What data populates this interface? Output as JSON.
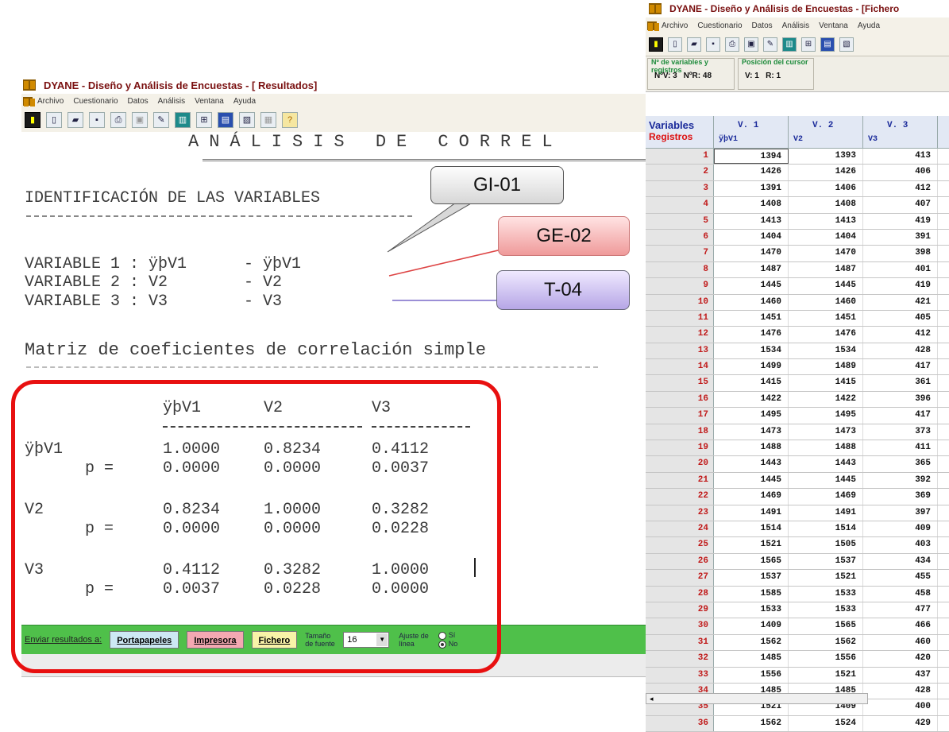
{
  "left_window": {
    "title": "DYANE - Diseño y Análisis de Encuestas - [ Resultados]",
    "menu": [
      "Archivo",
      "Cuestionario",
      "Datos",
      "Análisis",
      "Ventana",
      "Ayuda"
    ],
    "results": {
      "title": "ANÁLISIS DE CORREL",
      "ident_heading": "IDENTIFICACIÓN DE LAS VARIABLES",
      "variables": [
        "VARIABLE 1 : ÿþV1      - ÿþV1",
        "VARIABLE 2 : V2        - V2",
        "VARIABLE 3 : V3        - V3"
      ],
      "matrix_heading": "Matriz de coeficientes de correlación simple",
      "col_headers": [
        "ÿþV1",
        "V2",
        "V3"
      ],
      "rows": [
        {
          "name": "ÿþV1",
          "r": [
            "1.0000",
            "0.8234",
            "0.4112"
          ],
          "p_label": "p =",
          "p": [
            "0.0000",
            "0.0000",
            "0.0037"
          ]
        },
        {
          "name": "V2",
          "r": [
            "0.8234",
            "1.0000",
            "0.3282"
          ],
          "p_label": "p =",
          "p": [
            "0.0000",
            "0.0000",
            "0.0228"
          ]
        },
        {
          "name": "V3",
          "r": [
            "0.4112",
            "0.3282",
            "1.0000"
          ],
          "p_label": "p =",
          "p": [
            "0.0037",
            "0.0228",
            "0.0000"
          ]
        }
      ]
    },
    "statusbar": {
      "send_label": "Enviar resultados a:",
      "clipboard": "Portapapeles",
      "printer": "Impresora",
      "file": "Fichero",
      "font_size_label": "Tamaño de fuente",
      "font_size_value": "16",
      "wrap_label": "Ajuste de línea",
      "wrap_yes": "Sí",
      "wrap_no": "No"
    }
  },
  "callouts": [
    "GI-01",
    "GE-02",
    "T-04"
  ],
  "right_window": {
    "title": "DYANE - Diseño y Análisis de Encuestas - [Fichero",
    "menu": [
      "Archivo",
      "Cuestionario",
      "Datos",
      "Análisis",
      "Ventana",
      "Ayuda"
    ],
    "info": {
      "vars_label": "Nº de variables y registros",
      "nv": "NºV: 3",
      "nr": "NºR: 48",
      "cursor_label": "Posición del cursor",
      "cursor": "V: 1   R: 1"
    },
    "grid": {
      "corner_top": "Variables",
      "corner_bottom": "Registros",
      "columns": [
        {
          "code": "V. 1",
          "name": "ÿþV1"
        },
        {
          "code": "V. 2",
          "name": "V2"
        },
        {
          "code": "V. 3",
          "name": "V3"
        }
      ],
      "rows": [
        [
          "1",
          "1394",
          "1393",
          "413"
        ],
        [
          "2",
          "1426",
          "1426",
          "406"
        ],
        [
          "3",
          "1391",
          "1406",
          "412"
        ],
        [
          "4",
          "1408",
          "1408",
          "407"
        ],
        [
          "5",
          "1413",
          "1413",
          "419"
        ],
        [
          "6",
          "1404",
          "1404",
          "391"
        ],
        [
          "7",
          "1470",
          "1470",
          "398"
        ],
        [
          "8",
          "1487",
          "1487",
          "401"
        ],
        [
          "9",
          "1445",
          "1445",
          "419"
        ],
        [
          "10",
          "1460",
          "1460",
          "421"
        ],
        [
          "11",
          "1451",
          "1451",
          "405"
        ],
        [
          "12",
          "1476",
          "1476",
          "412"
        ],
        [
          "13",
          "1534",
          "1534",
          "428"
        ],
        [
          "14",
          "1499",
          "1489",
          "417"
        ],
        [
          "15",
          "1415",
          "1415",
          "361"
        ],
        [
          "16",
          "1422",
          "1422",
          "396"
        ],
        [
          "17",
          "1495",
          "1495",
          "417"
        ],
        [
          "18",
          "1473",
          "1473",
          "373"
        ],
        [
          "19",
          "1488",
          "1488",
          "411"
        ],
        [
          "20",
          "1443",
          "1443",
          "365"
        ],
        [
          "21",
          "1445",
          "1445",
          "392"
        ],
        [
          "22",
          "1469",
          "1469",
          "369"
        ],
        [
          "23",
          "1491",
          "1491",
          "397"
        ],
        [
          "24",
          "1514",
          "1514",
          "409"
        ],
        [
          "25",
          "1521",
          "1505",
          "403"
        ],
        [
          "26",
          "1565",
          "1537",
          "434"
        ],
        [
          "27",
          "1537",
          "1521",
          "455"
        ],
        [
          "28",
          "1585",
          "1533",
          "458"
        ],
        [
          "29",
          "1533",
          "1533",
          "477"
        ],
        [
          "30",
          "1409",
          "1565",
          "466"
        ],
        [
          "31",
          "1562",
          "1562",
          "460"
        ],
        [
          "32",
          "1485",
          "1556",
          "420"
        ],
        [
          "33",
          "1556",
          "1521",
          "437"
        ],
        [
          "34",
          "1485",
          "1485",
          "428"
        ],
        [
          "35",
          "1521",
          "1409",
          "400"
        ],
        [
          "36",
          "1562",
          "1524",
          "429"
        ]
      ]
    }
  }
}
